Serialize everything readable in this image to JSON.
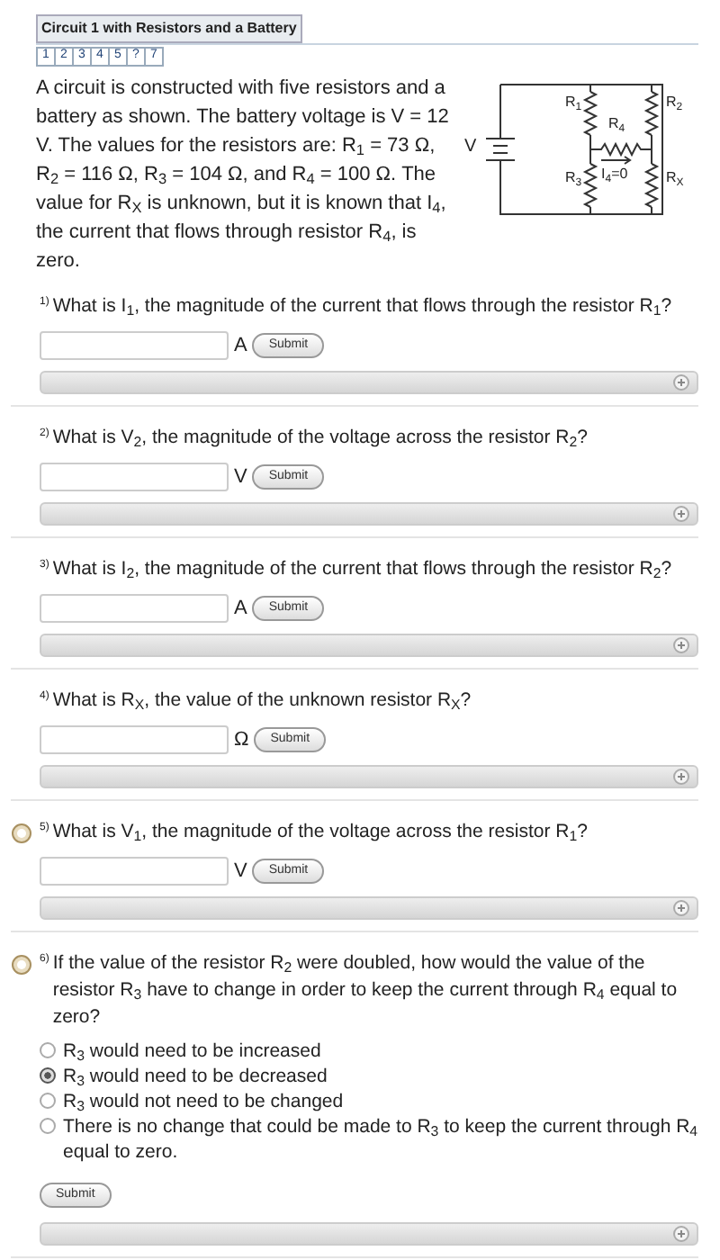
{
  "title": "Circuit 1 with Resistors and a Battery",
  "tabs": [
    "1",
    "2",
    "3",
    "4",
    "5",
    "?",
    "7"
  ],
  "intro": "A circuit is constructed with five resistors and a battery as shown. The battery voltage is V = 12 V. The values for the resistors are: R$_{1}$ = 73 Ω, R$_{2}$ = 116 Ω, R$_{3}$ = 104 Ω, and R$_{4}$ = 100 Ω. The value for R$_{X}$ is unknown, but it is known that I$_{4}$, the current that flows through resistor R$_{4}$, is zero.",
  "circuit": {
    "battery": "V",
    "r1": "R$_{1}$",
    "r2": "R$_{2}$",
    "r3": "R$_{3}$",
    "r4": "R$_{4}$",
    "rx": "R$_{X}$",
    "i4": "I$_{4}$=0"
  },
  "questions": [
    {
      "kind": "numeric",
      "number": "1)",
      "flagged": false,
      "text": "What is I$_{1}$, the magnitude of the current that flows through the resistor R$_{1}$?",
      "unit": "A",
      "button": "Submit"
    },
    {
      "kind": "numeric",
      "number": "2)",
      "flagged": false,
      "text": "What is V$_{2}$, the magnitude of the voltage across the resistor R$_{2}$?",
      "unit": "V",
      "button": "Submit"
    },
    {
      "kind": "numeric",
      "number": "3)",
      "flagged": false,
      "text": "What is I$_{2}$, the magnitude of the current that flows through the resistor R$_{2}$?",
      "unit": "A",
      "button": "Submit"
    },
    {
      "kind": "numeric",
      "number": "4)",
      "flagged": false,
      "text": "What is R$_{X}$, the value of the unknown resistor R$_{X}$?",
      "unit": "Ω",
      "button": "Submit"
    },
    {
      "kind": "numeric",
      "number": "5)",
      "flagged": true,
      "text": "What is V$_{1}$, the magnitude of the voltage across the resistor R$_{1}$?",
      "unit": "V",
      "button": "Submit"
    },
    {
      "kind": "choice",
      "number": "6)",
      "flagged": true,
      "text": "If the value of the resistor R$_{2}$ were doubled, how would the value of the resistor R$_{3}$ have to change in order to keep the current through R$_{4}$ equal to zero?",
      "button": "Submit",
      "options": [
        {
          "text": "R$_{3}$ would need to be increased",
          "selected": false
        },
        {
          "text": "R$_{3}$ would need to be decreased",
          "selected": true
        },
        {
          "text": "R$_{3}$ would not need to be changed",
          "selected": false
        },
        {
          "text": "There is no change that could be made to R$_{3}$ to keep the current through R$_{4}$ equal to zero.",
          "selected": false
        }
      ]
    }
  ]
}
